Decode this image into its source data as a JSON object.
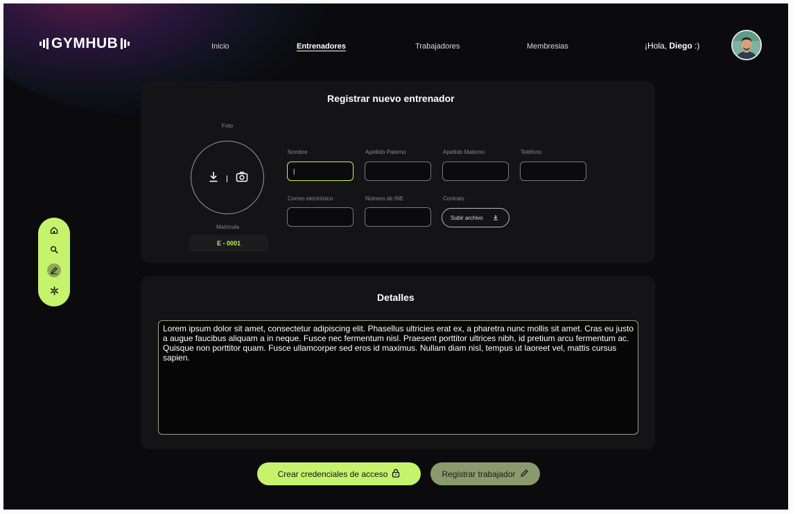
{
  "brand": {
    "logo_text": "GYMHUB"
  },
  "nav": [
    {
      "label": "Inicio",
      "active": false
    },
    {
      "label": "Entrenadores",
      "active": true
    },
    {
      "label": "Trabajadores",
      "active": false
    },
    {
      "label": "Membresias",
      "active": false
    }
  ],
  "user": {
    "greeting_prefix": "¡Hola, ",
    "name": "Diego",
    "greeting_suffix": " :)"
  },
  "register": {
    "title": "Registrar nuevo entrenador",
    "photo_label": "Foto",
    "photo_icons": [
      "download-icon",
      "camera-icon"
    ],
    "matricula_label": "Matrícula",
    "matricula_value": "E - 0001",
    "fields": {
      "nombre": {
        "label": "Nombre",
        "value": "|"
      },
      "apellido_paterno": {
        "label": "Apellido Paterno",
        "value": ""
      },
      "apellido_materno": {
        "label": "Apellido Materno",
        "value": ""
      },
      "telefono": {
        "label": "Teléfono",
        "value": ""
      },
      "correo": {
        "label": "Correo electrónico",
        "value": ""
      },
      "ine": {
        "label": "Número de INE",
        "value": ""
      },
      "contrato": {
        "label": "Contrato",
        "button_label": "Subir archivo"
      }
    }
  },
  "details": {
    "title": "Detalles",
    "text": "Lorem ipsum dolor sit amet, consectetur adipiscing elit. Phasellus ultricies erat ex, a pharetra nunc mollis sit amet. Cras eu justo a augue faucibus aliquam a in neque. Fusce nec fermentum nisl. Praesent porttitor ultrices nibh, id pretium arcu fermentum ac. Quisque non porttitor quam. Fusce ullamcorper sed eros id maximus. Nullam diam nisl, tempus ut laoreet vel, mattis cursus sapien."
  },
  "sidebar": {
    "icons": [
      "home-icon",
      "search-icon",
      "edit-icon",
      "settings-icon"
    ],
    "active": "edit-icon"
  },
  "actions": {
    "primary_label": "Crear credenciales de acceso",
    "secondary_label": "Registrar trabajador"
  },
  "colors": {
    "accent": "#c6f36c",
    "background": "#0b0b0d",
    "panel": "#141416",
    "secondary_button": "#8a9a6c"
  }
}
